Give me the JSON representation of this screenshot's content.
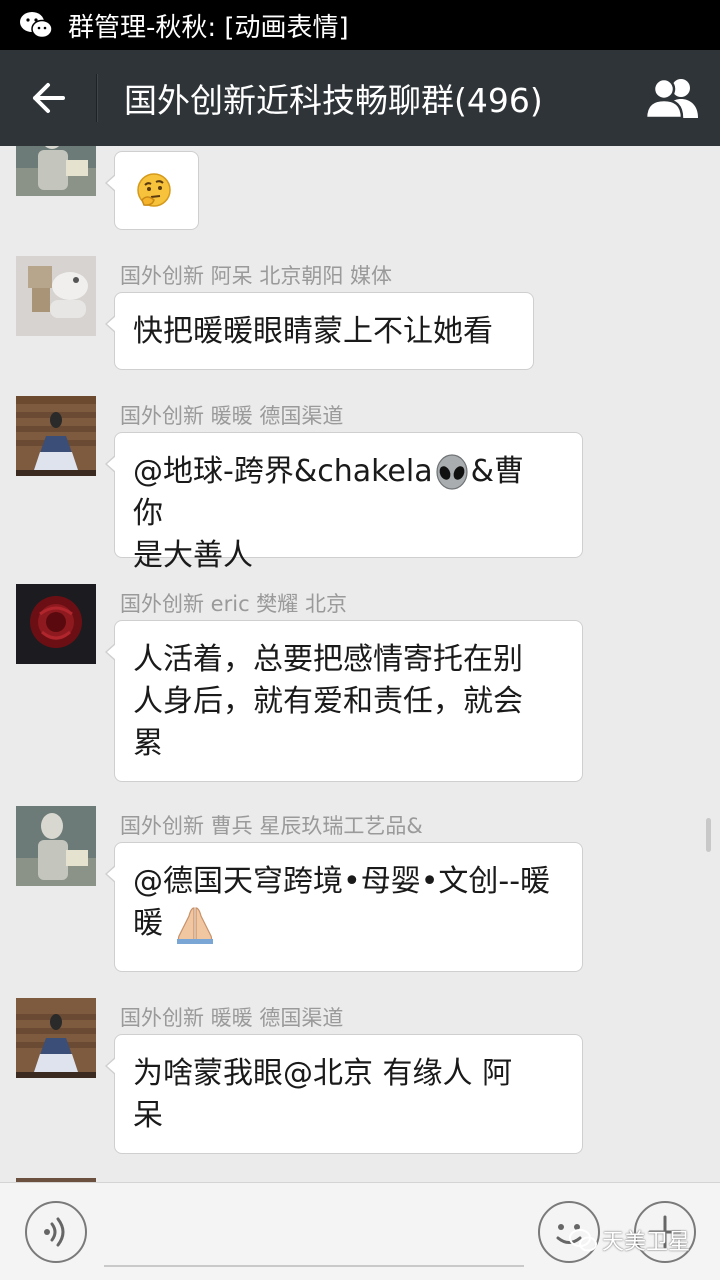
{
  "status_bar": {
    "notification": "群管理-秋秋: [动画表情]"
  },
  "header": {
    "title": "国外创新近科技畅聊群(496)"
  },
  "messages": [
    {
      "sender": "",
      "text": "",
      "emoji": "thinking-face"
    },
    {
      "sender": "国外创新 阿呆 北京朝阳 媒体",
      "text": "快把暖暖眼睛蒙上不让她看"
    },
    {
      "sender": "国外创新 暖暖 德国渠道",
      "line1a": "@地球-跨界&chakela",
      "line1b": "&曹 你",
      "line2": "是大善人"
    },
    {
      "sender": "国外创新 eric 樊耀 北京",
      "line1": "人活着，总要把感情寄托在别",
      "line2": "人身后，就有爱和责任，就会",
      "line3": "累"
    },
    {
      "sender": "国外创新 曹兵 星辰玖瑞工艺品&",
      "line1": "@德国天穹跨境•母婴•文创--暖",
      "line2": "暖"
    },
    {
      "sender": "国外创新 暖暖 德国渠道",
      "line1": "为啥蒙我眼@北京 有缘人 阿",
      "line2": "呆"
    }
  ],
  "input": {
    "value": "",
    "placeholder": ""
  },
  "watermark": {
    "text": "天美卫星"
  },
  "colors": {
    "status_bar": "#000000",
    "title_bar": "#2f3438",
    "chat_bg": "#ebebeb",
    "bubble": "#ffffff",
    "sender_text": "#9a9a9a"
  }
}
